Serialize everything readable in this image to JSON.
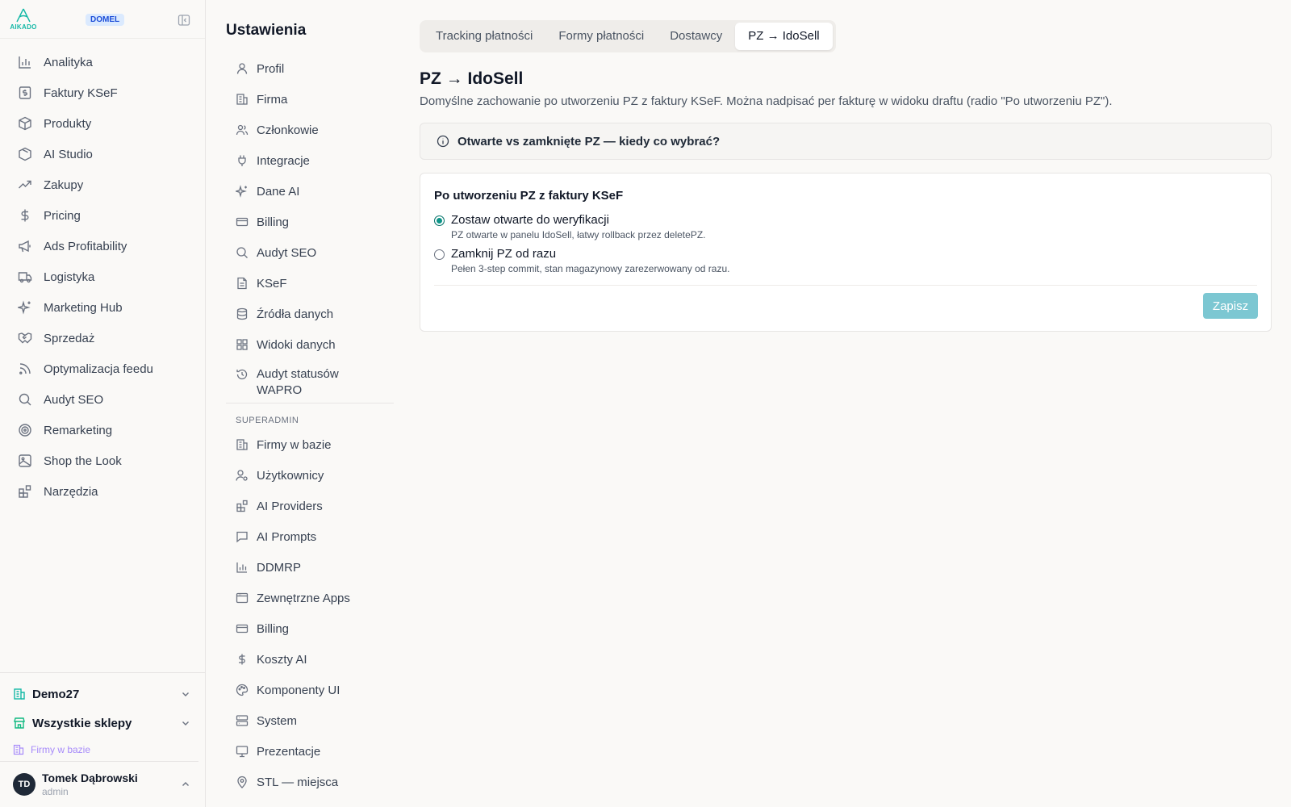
{
  "brand": {
    "logo_text": "AIKADO",
    "tenant_badge": "DOMEL",
    "accent": "#14b8a6"
  },
  "sidebar": {
    "items": [
      {
        "label": "Analityka",
        "icon": "bar-chart-icon"
      },
      {
        "label": "Faktury KSeF",
        "icon": "invoice-dollar-icon"
      },
      {
        "label": "Produkty",
        "icon": "package-icon"
      },
      {
        "label": "AI Studio",
        "icon": "box-icon"
      },
      {
        "label": "Zakupy",
        "icon": "trending-up-icon"
      },
      {
        "label": "Pricing",
        "icon": "dollar-icon"
      },
      {
        "label": "Ads Profitability",
        "icon": "megaphone-icon"
      },
      {
        "label": "Logistyka",
        "icon": "truck-icon"
      },
      {
        "label": "Marketing Hub",
        "icon": "sparkles-icon"
      },
      {
        "label": "Sprzedaż",
        "icon": "handshake-icon"
      },
      {
        "label": "Optymalizacja feedu",
        "icon": "rss-icon"
      },
      {
        "label": "Audyt SEO",
        "icon": "search-icon"
      },
      {
        "label": "Remarketing",
        "icon": "target-icon"
      },
      {
        "label": "Shop the Look",
        "icon": "image-icon"
      },
      {
        "label": "Narzędzia",
        "icon": "blocks-icon"
      }
    ],
    "org": "Demo27",
    "store": "Wszystkie sklepy",
    "firm_link": "Firmy w bazie",
    "user": {
      "initials": "TD",
      "name": "Tomek Dąbrowski",
      "role": "admin"
    }
  },
  "settings": {
    "title": "Ustawienia",
    "items": [
      {
        "label": "Profil"
      },
      {
        "label": "Firma"
      },
      {
        "label": "Członkowie"
      },
      {
        "label": "Integracje"
      },
      {
        "label": "Dane AI"
      },
      {
        "label": "Billing"
      },
      {
        "label": "Audyt SEO"
      },
      {
        "label": "KSeF"
      },
      {
        "label": "Źródła danych"
      },
      {
        "label": "Widoki danych"
      },
      {
        "label": "Audyt statusów WAPRO"
      }
    ],
    "superadmin_label": "SUPERADMIN",
    "superadmin_items": [
      {
        "label": "Firmy w bazie"
      },
      {
        "label": "Użytkownicy"
      },
      {
        "label": "AI Providers"
      },
      {
        "label": "AI Prompts"
      },
      {
        "label": "DDMRP"
      },
      {
        "label": "Zewnętrzne Apps"
      },
      {
        "label": "Billing"
      },
      {
        "label": "Koszty AI"
      },
      {
        "label": "Komponenty UI"
      },
      {
        "label": "System"
      },
      {
        "label": "Prezentacje"
      },
      {
        "label": "STL — miejsca"
      }
    ]
  },
  "main": {
    "tabs": [
      {
        "label": "Tracking płatności"
      },
      {
        "label": "Formy płatności"
      },
      {
        "label": "Dostawcy"
      },
      {
        "label": "PZ → IdoSell"
      }
    ],
    "active_tab": 3,
    "title": "PZ → IdoSell",
    "description": "Domyślne zachowanie po utworzeniu PZ z faktury KSeF. Można nadpisać per fakturę w widoku draftu (radio \"Po utworzeniu PZ\").",
    "info_box": "Otwarte vs zamknięte PZ — kiedy co wybrać?",
    "card": {
      "title": "Po utworzeniu PZ z faktury KSeF",
      "options": [
        {
          "label": "Zostaw otwarte do weryfikacji",
          "help": "PZ otwarte w panelu IdoSell, łatwy rollback przez deletePZ.",
          "checked": true
        },
        {
          "label": "Zamknij PZ od razu",
          "help": "Pełen 3-step commit, stan magazynowy zarezerwowany od razu.",
          "checked": false
        }
      ],
      "save_label": "Zapisz"
    }
  }
}
